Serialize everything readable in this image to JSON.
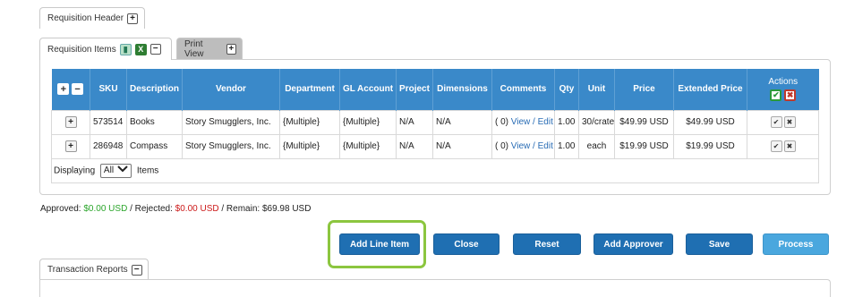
{
  "tabs": {
    "requisition_header": "Requisition Header",
    "requisition_items": "Requisition Items",
    "print_view": "Print View",
    "transaction_reports": "Transaction Reports"
  },
  "table": {
    "columns": [
      "SKU",
      "Description",
      "Vendor",
      "Department",
      "GL Account",
      "Project",
      "Dimensions",
      "Comments",
      "Qty",
      "Unit",
      "Price",
      "Extended Price",
      "Actions"
    ],
    "rows": [
      {
        "sku": "573514",
        "description": "Books",
        "vendor": "Story Smugglers, Inc.",
        "department": "{Multiple}",
        "gl_account": "{Multiple}",
        "project": "N/A",
        "dimensions": "N/A",
        "comments_count": "( 0)",
        "comments_link": "View / Edit",
        "qty": "1.00",
        "unit": "30/crate",
        "price": "$49.99 USD",
        "extended_price": "$49.99 USD"
      },
      {
        "sku": "286948",
        "description": "Compass",
        "vendor": "Story Smugglers, Inc.",
        "department": "{Multiple}",
        "gl_account": "{Multiple}",
        "project": "N/A",
        "dimensions": "N/A",
        "comments_count": "( 0)",
        "comments_link": "View / Edit",
        "qty": "1.00",
        "unit": "each",
        "price": "$19.99 USD",
        "extended_price": "$19.99 USD"
      }
    ],
    "footer": {
      "displaying_label": "Displaying",
      "displaying_value": "All",
      "items_label": "Items"
    }
  },
  "summary": {
    "approved_label": "Approved:",
    "approved_value": "$0.00 USD",
    "rejected_label": "/ Rejected:",
    "rejected_value": "$0.00 USD",
    "remain_label": "/ Remain:",
    "remain_value": "$69.98 USD"
  },
  "buttons": {
    "add_line_item": "Add Line Item",
    "close": "Close",
    "reset": "Reset",
    "add_approver": "Add Approver",
    "save": "Save",
    "process": "Process"
  },
  "colors": {
    "header_blue": "#3a89c9",
    "button_blue": "#1f6fb2",
    "process_blue": "#4aa7de",
    "approved_green": "#2aa52a",
    "rejected_red": "#cc1a1a",
    "highlight_green": "#8cc63f"
  }
}
